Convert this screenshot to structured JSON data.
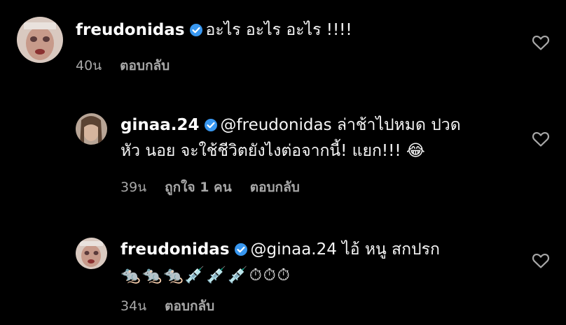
{
  "comments": [
    {
      "username": "freudonidas",
      "text": "อะไร อะไร อะไร !!!!",
      "time": "40น",
      "likes": "",
      "reply_label": "ตอบกลับ"
    },
    {
      "username": "ginaa.24",
      "text_line1": "@freudonidas ล่าช้าไปหมด ปวด",
      "text_line2": "หัว นอย จะใช้ชีวิตยังไงต่อจากนี้! แยก!!! 😂",
      "time": "39น",
      "likes": "ถูกใจ 1 คน",
      "reply_label": "ตอบกลับ"
    },
    {
      "username": "freudonidas",
      "text_line1": "@ginaa.24 ไอ้ หนู สกปรก",
      "text_line2": "🐀🐀🐀💉💉💉⏱⏱⏱",
      "time": "34น",
      "reply_label": "ตอบกลับ"
    }
  ],
  "colors": {
    "background": "#000000",
    "text": "#f5f5f5",
    "meta": "#a8a8a8",
    "verified": "#3897f0"
  },
  "icons": [
    "verified-badge-icon",
    "heart-icon",
    "avatar"
  ]
}
